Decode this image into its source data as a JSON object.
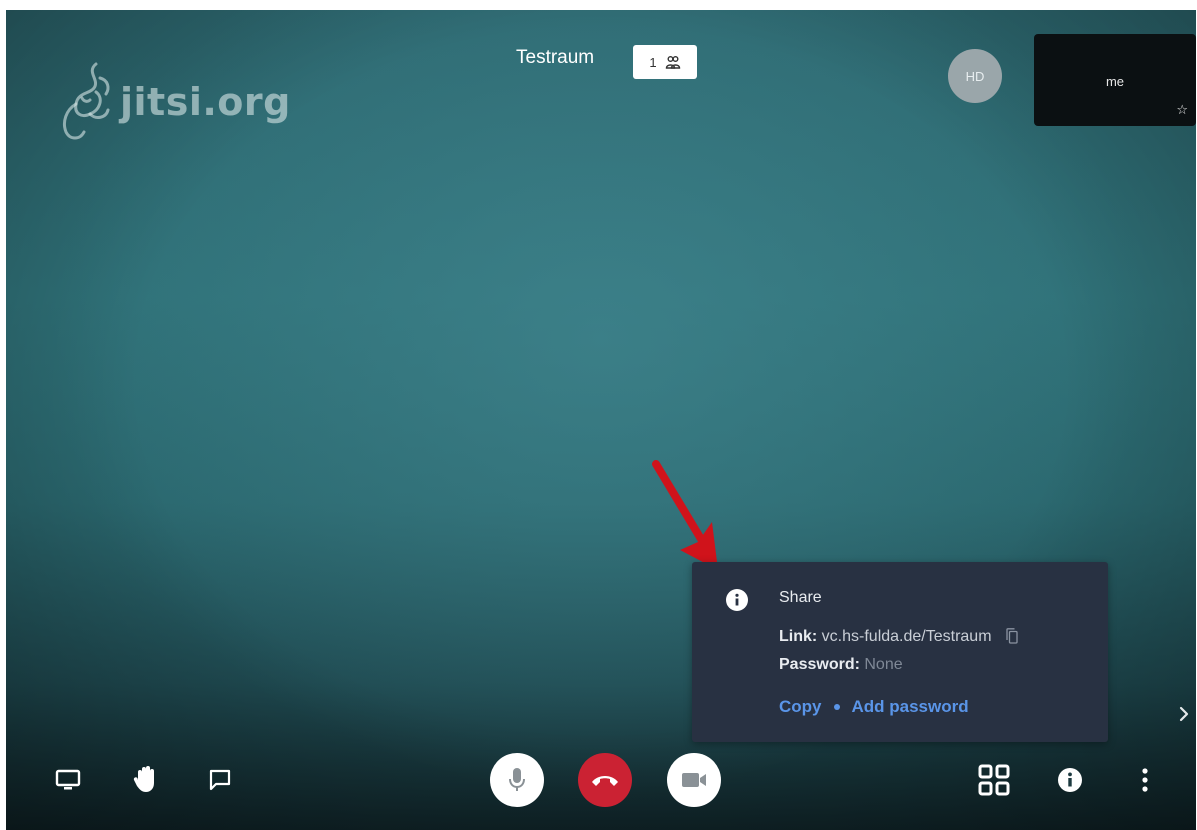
{
  "room": {
    "title": "Testraum",
    "participant_count": "1",
    "participant_icon": "participants-icon"
  },
  "brand": {
    "logo_text": "jitsi.org",
    "logo_icon": "jitsi-logo-icon"
  },
  "remote_avatar": {
    "initials": "HD"
  },
  "local_thumbnail": {
    "name": "me",
    "icon": "star-icon"
  },
  "share_dialog": {
    "title": "Share",
    "info_icon": "info-icon",
    "link_label": "Link:",
    "link_value": "vc.hs-fulda.de/Testraum",
    "copy_link_icon": "copy-icon",
    "password_label": "Password:",
    "password_value": "None",
    "copy_action": "Copy",
    "add_password_action": "Add password"
  },
  "toolbar": {
    "left": [
      "screen-share-icon",
      "raise-hand-icon",
      "chat-icon"
    ],
    "center": [
      "microphone-icon",
      "hangup-icon",
      "camera-icon"
    ],
    "right": [
      "tile-view-icon",
      "info-icon",
      "more-options-icon"
    ]
  },
  "colors": {
    "accent_link": "#5a95e8",
    "hangup": "#cb2233",
    "dialog_bg": "#283142",
    "annotation_arrow": "#d0131b"
  }
}
